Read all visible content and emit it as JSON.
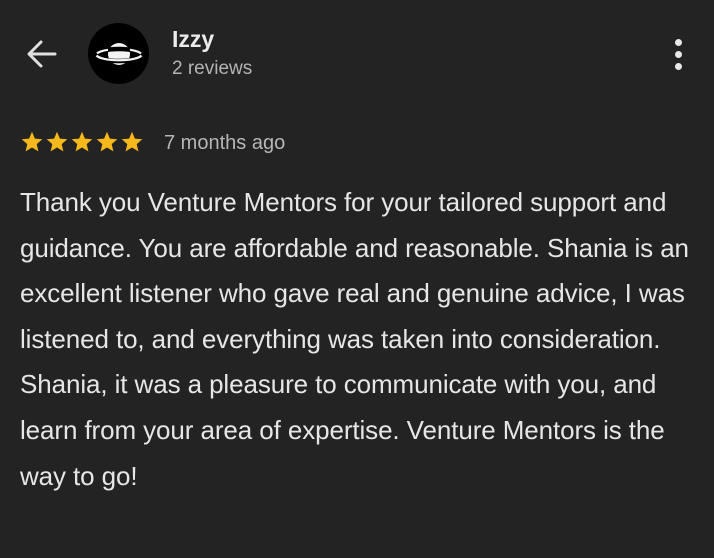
{
  "header": {
    "back_icon": "arrow-left-icon",
    "avatar_icon": "saturn-planet-icon",
    "reviewer_name": "Izzy",
    "review_count": "2 reviews",
    "more_icon": "more-vertical-icon"
  },
  "review": {
    "rating": 5,
    "rating_max": 5,
    "star_color": "#f6b81a",
    "time_ago": "7 months ago",
    "text": "Thank you Venture Mentors for your tailored support and guidance. You are affordable and reasonable. Shania is an excellent listener who gave real and genuine advice, I was listened to, and everything was taken into consideration. Shania, it was a pleasure to communicate with you, and learn from your area of expertise. Venture Mentors is the way to go!"
  },
  "colors": {
    "background": "#232323",
    "text_primary": "#e6e6e6",
    "text_secondary": "#b4b4b4"
  }
}
